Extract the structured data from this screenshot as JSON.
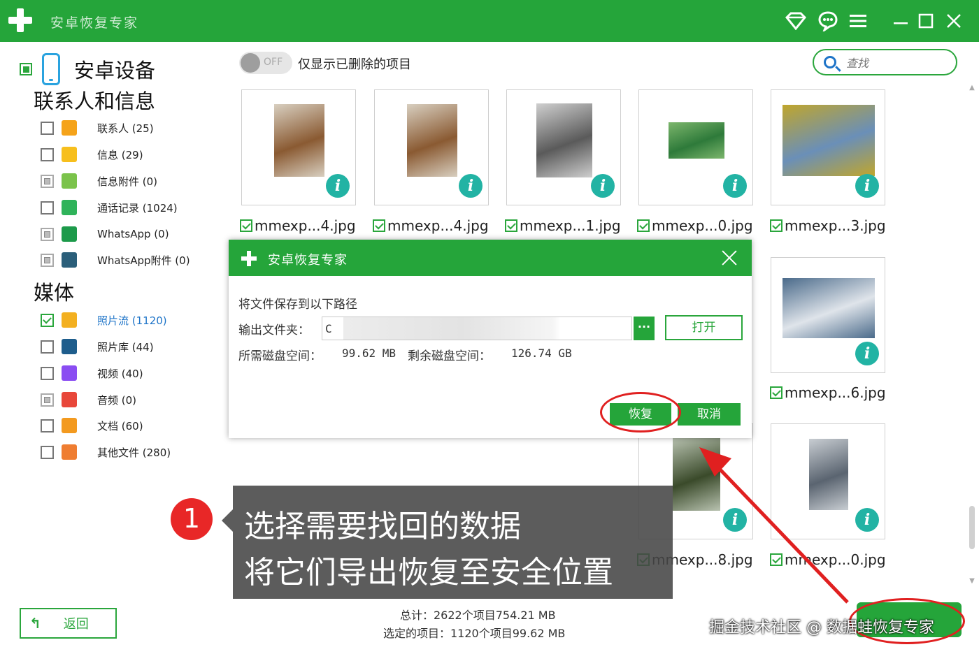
{
  "app": {
    "title": "安卓恢复专家"
  },
  "sidebar": {
    "device_label": "安卓设备",
    "section_contacts": "联系人和信息",
    "section_media": "媒体",
    "items": [
      {
        "label": "联系人 (25)",
        "icon": "contact-icon",
        "color": "#f5a31a",
        "state": "unchecked",
        "active": false
      },
      {
        "label": "信息 (29)",
        "icon": "message-icon",
        "color": "#f7bf1d",
        "state": "unchecked",
        "active": false
      },
      {
        "label": "信息附件 (0)",
        "icon": "attachment-icon",
        "color": "#7bc34b",
        "state": "partial",
        "active": false
      },
      {
        "label": "通话记录 (1024)",
        "icon": "phone-call-icon",
        "color": "#2fb35a",
        "state": "unchecked",
        "active": false
      },
      {
        "label": "WhatsApp (0)",
        "icon": "whatsapp-icon",
        "color": "#1c9a4a",
        "state": "partial",
        "active": false
      },
      {
        "label": "WhatsApp附件 (0)",
        "icon": "whatsapp-attachment-icon",
        "color": "#2b5f7a",
        "state": "partial",
        "active": false
      },
      {
        "label": "照片流 (1120)",
        "icon": "star-photo-icon",
        "color": "#f3b020",
        "state": "checked",
        "active": true
      },
      {
        "label": "照片库 (44)",
        "icon": "gallery-icon",
        "color": "#1e5d8c",
        "state": "unchecked",
        "active": false
      },
      {
        "label": "视频 (40)",
        "icon": "video-icon",
        "color": "#8a4df2",
        "state": "unchecked",
        "active": false
      },
      {
        "label": "音频 (0)",
        "icon": "audio-icon",
        "color": "#e8473a",
        "state": "partial",
        "active": false
      },
      {
        "label": "文档 (60)",
        "icon": "document-icon",
        "color": "#f39a1f",
        "state": "unchecked",
        "active": false
      },
      {
        "label": "其他文件 (280)",
        "icon": "other-file-icon",
        "color": "#ef7d31",
        "state": "unchecked",
        "active": false
      }
    ],
    "back_label": "返回"
  },
  "toolbar": {
    "toggle_text": "OFF",
    "toggle_label": "仅显示已删除的项目",
    "search_placeholder": "查找"
  },
  "files": [
    {
      "name": "mmexp...4.jpg",
      "colors": [
        "#8a5a32",
        "#d8cfc0"
      ]
    },
    {
      "name": "mmexp...4.jpg",
      "colors": [
        "#8a5a32",
        "#d8cfc0"
      ]
    },
    {
      "name": "mmexp...1.jpg",
      "colors": [
        "#5a5a5a",
        "#cfcfcf"
      ]
    },
    {
      "name": "mmexp...0.jpg",
      "colors": [
        "#2e7a3a",
        "#7cb66c"
      ]
    },
    {
      "name": "mmexp...3.jpg",
      "colors": [
        "#6a8fb8",
        "#c0a62c"
      ]
    },
    {
      "name": "mmexp...6.jpg",
      "colors": [
        "#dfe4ea",
        "#4a6a8a"
      ]
    },
    {
      "name": "mmexp...8.jpg",
      "colors": [
        "#3a4a2a",
        "#b8c2b0"
      ]
    },
    {
      "name": "mmexp...0.jpg",
      "colors": [
        "#5a6470",
        "#c8cdd2"
      ]
    }
  ],
  "footer": {
    "totals": "总计：2622个项目754.21 MB",
    "selected": "选定的项目：1120个项目99.62 MB",
    "watermark": "掘金技术社区 @ 数据蛙恢复专家"
  },
  "dialog": {
    "title": "安卓恢复专家",
    "prompt": "将文件保存到以下路径",
    "output_label": "输出文件夹：",
    "output_path": "C",
    "browse_label": "···",
    "open_label": "打开",
    "required_label": "所需磁盘空间：",
    "required_value": "99.62 MB",
    "free_label": "剩余磁盘空间：",
    "free_value": "126.74 GB",
    "ok_label": "恢复",
    "cancel_label": "取消"
  },
  "annotation": {
    "step": "1",
    "line1": "选择需要找回的数据",
    "line2": "将它们导出恢复至安全位置"
  }
}
